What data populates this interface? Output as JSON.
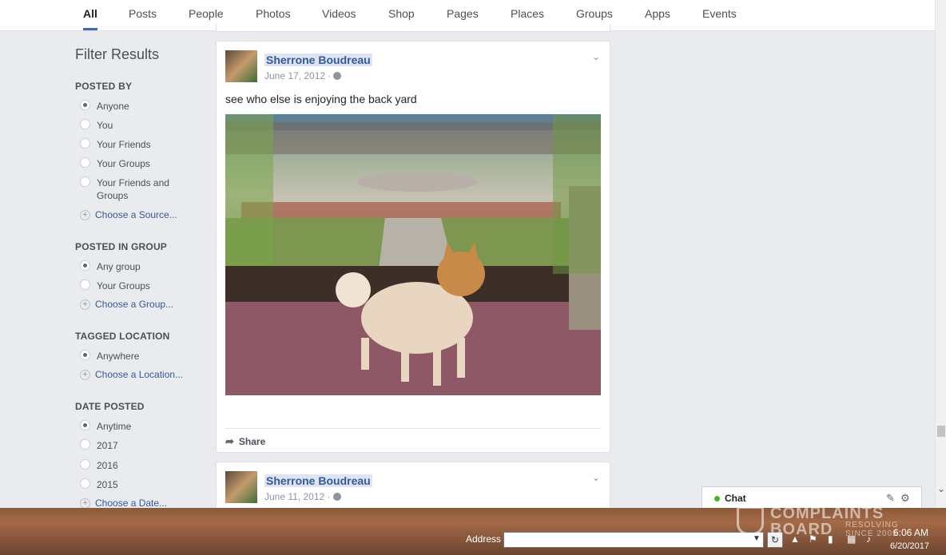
{
  "tabs": [
    "All",
    "Posts",
    "People",
    "Photos",
    "Videos",
    "Shop",
    "Pages",
    "Places",
    "Groups",
    "Apps",
    "Events"
  ],
  "filters": {
    "title": "Filter Results",
    "posted_by": {
      "heading": "POSTED BY",
      "options": [
        "Anyone",
        "You",
        "Your Friends",
        "Your Groups",
        "Your Friends and Groups"
      ],
      "choose": "Choose a Source..."
    },
    "posted_in_group": {
      "heading": "POSTED IN GROUP",
      "options": [
        "Any group",
        "Your Groups"
      ],
      "choose": "Choose a Group..."
    },
    "tagged_location": {
      "heading": "TAGGED LOCATION",
      "options": [
        "Anywhere"
      ],
      "choose": "Choose a Location..."
    },
    "date_posted": {
      "heading": "DATE POSTED",
      "options": [
        "Anytime",
        "2017",
        "2016",
        "2015"
      ],
      "choose": "Choose a Date..."
    }
  },
  "posts": [
    {
      "author": "Sherrone Boudreau",
      "date": "June 17, 2012 ·",
      "text": "see who else is enjoying the back yard",
      "share_label": "Share"
    },
    {
      "author": "Sherrone Boudreau",
      "date": "June 11, 2012 ·"
    }
  ],
  "chat": {
    "label": "Chat"
  },
  "taskbar": {
    "address_label": "Address",
    "address_value": "",
    "time": "6:06 AM",
    "date": "6/20/2017"
  },
  "watermark": {
    "line1": "COMPLAINTS",
    "line2": "BOARD",
    "sub1": "RESOLVING",
    "sub2": "SINCE 2005"
  }
}
